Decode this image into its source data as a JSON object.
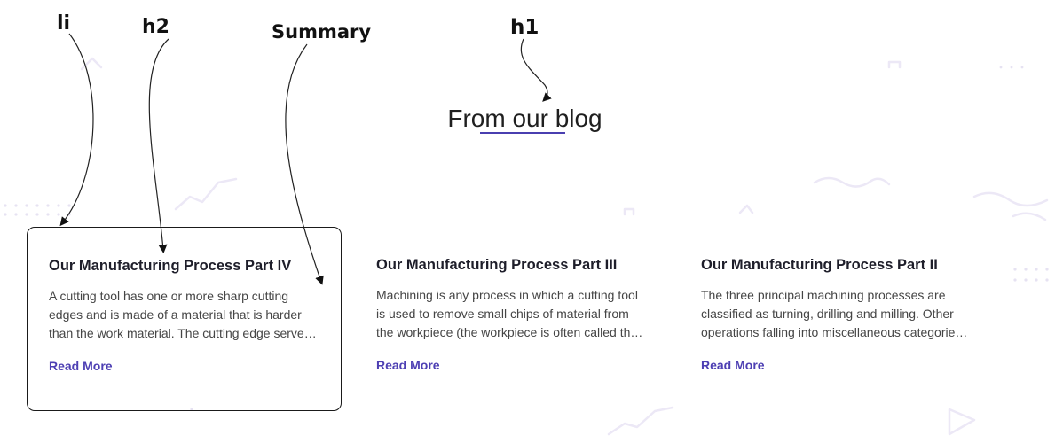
{
  "annotations": {
    "li": "li",
    "h2": "h2",
    "summary": "Summary",
    "h1": "h1"
  },
  "header": {
    "title": "From our blog"
  },
  "posts": [
    {
      "title": "Our Manufacturing Process Part IV",
      "summary": "A cutting tool has one or more sharp cutting edges and is made of a material that is harder than the work material. The cutting edge serves to separate chip from the parent work material.",
      "read_more": "Read More"
    },
    {
      "title": "Our Manufacturing Process Part III",
      "summary": "Machining is any process in which a cutting tool is used to remove small chips of material from the workpiece (the workpiece is often called the work).",
      "read_more": "Read More"
    },
    {
      "title": "Our Manufacturing Process Part II",
      "summary": "The three principal machining processes are classified as turning, drilling and milling. Other operations falling into miscellaneous categories include shaping and planing.",
      "read_more": "Read More"
    }
  ],
  "colors": {
    "accent": "#4d3fb3",
    "decoration": "#ede9f7"
  }
}
